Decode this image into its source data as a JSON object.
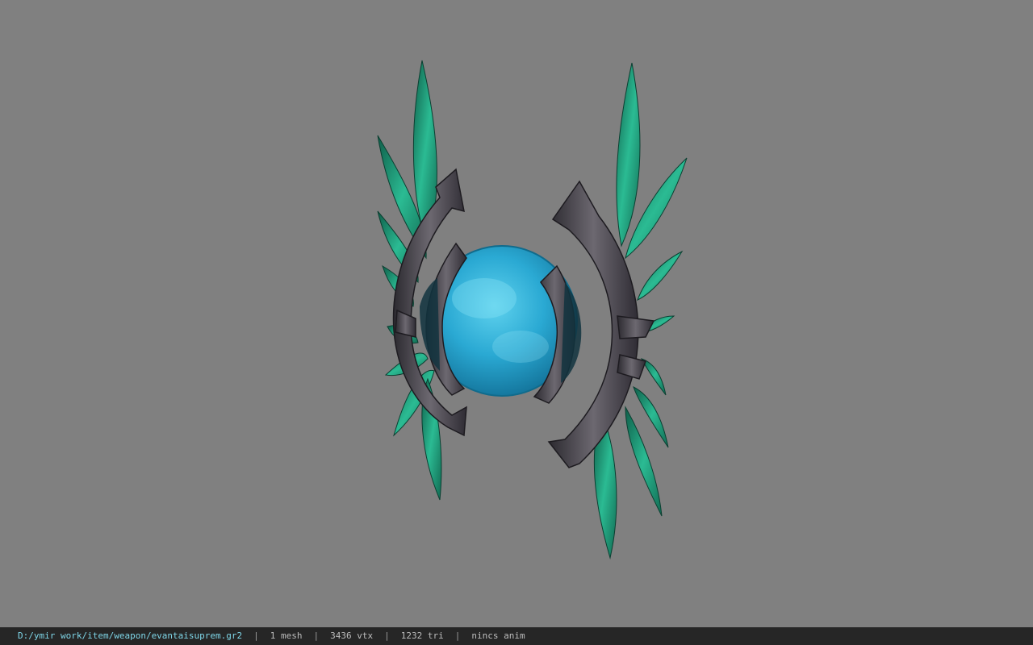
{
  "viewer": {
    "background_color": "#808080",
    "model_colors": {
      "orb": "#2fb6d8",
      "leaf": "#1fa583",
      "metal": "#4a4650"
    }
  },
  "status_bar": {
    "file_path": "D:/ymir work/item/weapon/evantaisuprem.gr2",
    "separator": "|",
    "mesh_count": "1 mesh",
    "vertex_count": "3436 vtx",
    "triangle_count": "1232 tri",
    "anim_status": "nincs anim"
  }
}
